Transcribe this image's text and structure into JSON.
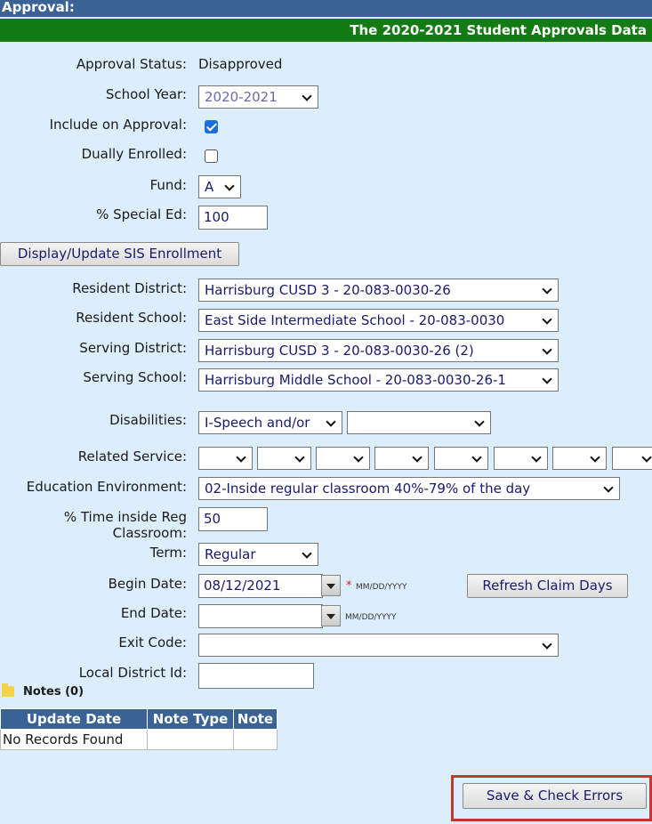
{
  "header": {
    "section_title": "Approval:",
    "banner_title": "The 2020-2021 Student Approvals Data"
  },
  "form": {
    "approval_status": {
      "label": "Approval Status:",
      "value": "Disapproved"
    },
    "school_year": {
      "label": "School Year:",
      "value": "2020-2021"
    },
    "include_on_approval": {
      "label": "Include on Approval:",
      "checked": true
    },
    "dually_enrolled": {
      "label": "Dually Enrolled:",
      "checked": false
    },
    "fund": {
      "label": "Fund:",
      "value": "A"
    },
    "special_ed": {
      "label": "% Special Ed:",
      "value": "100"
    },
    "display_update_button": "Display/Update SIS Enrollment",
    "resident_district": {
      "label": "Resident District:",
      "value": "Harrisburg CUSD 3 - 20-083-0030-26"
    },
    "resident_school": {
      "label": "Resident School:",
      "value": "East Side Intermediate School - 20-083-0030"
    },
    "serving_district": {
      "label": "Serving District:",
      "value": "Harrisburg CUSD 3 - 20-083-0030-26 (2)"
    },
    "serving_school": {
      "label": "Serving School:",
      "value": "Harrisburg Middle School - 20-083-0030-26-1"
    },
    "disabilities": {
      "label": "Disabilities:",
      "value1": "I-Speech and/or",
      "value2": ""
    },
    "related_service": {
      "label": "Related Service:",
      "values": [
        "",
        "",
        "",
        "",
        "",
        "",
        "",
        ""
      ]
    },
    "education_environment": {
      "label": "Education Environment:",
      "value": "02-Inside regular classroom 40%-79% of the day"
    },
    "time_inside_reg": {
      "label_line1": "% Time inside Reg",
      "label_line2": "Classroom:",
      "value": "50"
    },
    "term": {
      "label": "Term:",
      "value": "Regular"
    },
    "begin_date": {
      "label": "Begin Date:",
      "value": "08/12/2021",
      "required_mark": "*",
      "format_hint": "MM/DD/YYYY"
    },
    "refresh_button": "Refresh Claim Days",
    "end_date": {
      "label": "End Date:",
      "value": "",
      "format_hint": "MM/DD/YYYY"
    },
    "exit_code": {
      "label": "Exit Code:",
      "value": ""
    },
    "local_district_id": {
      "label": "Local District Id:",
      "value": ""
    }
  },
  "notes": {
    "title": "Notes (0)",
    "columns": [
      "Update Date",
      "Note Type",
      "Note"
    ],
    "empty_message": "No Records Found"
  },
  "footer": {
    "save_button": "Save & Check Errors"
  },
  "colors": {
    "header_blue": "#3a6294",
    "banner_green": "#147a14",
    "page_background": "#dcedfb",
    "highlight_red": "#c0392b"
  }
}
